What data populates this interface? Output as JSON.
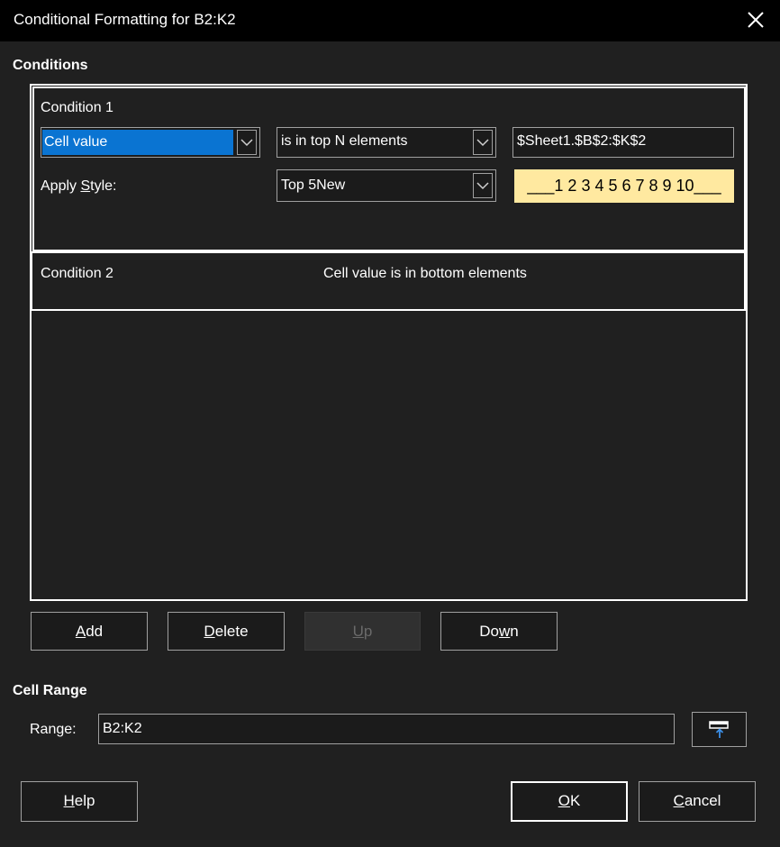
{
  "window": {
    "title": "Conditional Formatting for B2:K2",
    "close_icon": "close-icon"
  },
  "conditions": {
    "heading": "Conditions",
    "condition1": {
      "label": "Condition 1",
      "source": "Cell value",
      "operator": "is in top N elements",
      "value": "$Sheet1.$B$2:$K$2",
      "apply_style_prefix": "Apply ",
      "apply_style_key": "S",
      "apply_style_suffix": "tyle:",
      "style": "Top 5New",
      "preview": "___1 2 3 4 5 6 7 8 9 10___",
      "preview_bg": "#ffe9a0"
    },
    "condition2": {
      "label": "Condition 2",
      "summary": "Cell value is in bottom elements"
    }
  },
  "buttons": {
    "add": {
      "key": "A",
      "rest": "dd"
    },
    "delete": {
      "key": "D",
      "rest": "elete"
    },
    "up": {
      "key": "U",
      "rest": "p"
    },
    "down": {
      "pre": "Do",
      "key": "w",
      "rest": "n"
    },
    "help": {
      "key": "H",
      "rest": "elp"
    },
    "ok": {
      "key": "O",
      "rest": "K"
    },
    "cancel": {
      "key": "C",
      "rest": "ancel"
    }
  },
  "cell_range": {
    "heading": "Cell Range",
    "label_pre": "Ran",
    "label_key": "g",
    "label_rest": "e:",
    "value": "B2:K2"
  },
  "colors": {
    "background": "#202020",
    "titlebar": "#000000",
    "selection": "#0a74d2"
  }
}
